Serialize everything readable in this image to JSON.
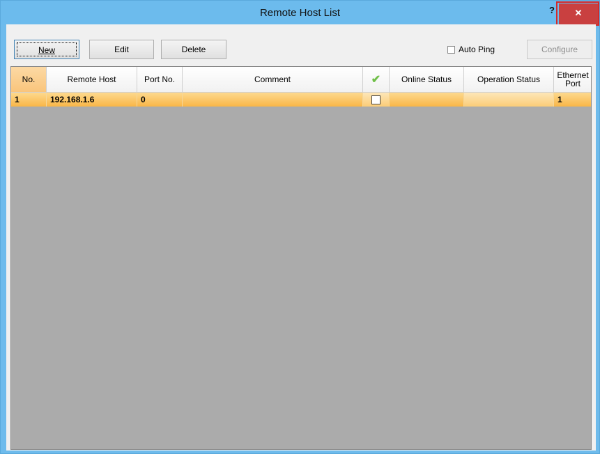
{
  "window": {
    "title": "Remote Host List",
    "help_label": "?",
    "close_label": "✕"
  },
  "toolbar": {
    "new_label": "New",
    "edit_label": "Edit",
    "delete_label": "Delete",
    "auto_ping_label": "Auto Ping",
    "auto_ping_checked": false,
    "configure_label": "Configure"
  },
  "table": {
    "columns": [
      {
        "label": "No."
      },
      {
        "label": "Remote Host"
      },
      {
        "label": "Port No."
      },
      {
        "label": "Comment"
      },
      {
        "label": "check-icon"
      },
      {
        "label": "Online Status"
      },
      {
        "label": "Operation Status"
      },
      {
        "label_line1": "Ethernet",
        "label_line2": "Port"
      }
    ],
    "rows": [
      {
        "no": "1",
        "remote_host": "192.168.1.6",
        "port_no": "0",
        "comment": "",
        "checked": false,
        "online_status": "",
        "operation_status": "",
        "ethernet_port": "1"
      }
    ]
  },
  "colors": {
    "title_bar": "#6cbbed",
    "close_button": "#c94040",
    "selected_row": "#f9b647",
    "empty_grid": "#ababab"
  }
}
